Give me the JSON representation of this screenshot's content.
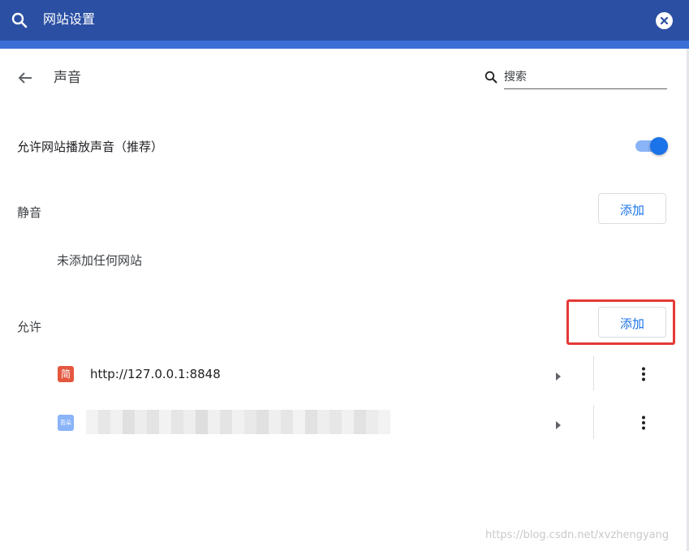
{
  "topbar": {
    "title": "网站设置",
    "search_icon": "search-icon",
    "close_icon": "close-circle-icon",
    "bg_color": "#2a4fa3"
  },
  "header": {
    "back_icon": "arrow-back-icon",
    "title": "声音",
    "search": {
      "icon": "search-icon",
      "placeholder": "搜索",
      "value": ""
    }
  },
  "allow_sound": {
    "label": "允许网站播放声音（推荐）",
    "toggle_on": true,
    "accent_color": "#1a73e8"
  },
  "mute_section": {
    "label": "静音",
    "add_label": "添加",
    "empty_text": "未添加任何网站"
  },
  "allow_section": {
    "label": "允许",
    "add_label": "添加",
    "highlight_color": "#e53935",
    "sites": [
      {
        "favicon_text": "简",
        "favicon_color": "#e4573f",
        "url": "http://127.0.0.1:8848",
        "arrow_icon": "triangle-right-icon",
        "more_icon": "more-vert-icon"
      },
      {
        "favicon_text": "吾朵",
        "favicon_color": "#8ab4f8",
        "url": "",
        "blurred": true,
        "arrow_icon": "triangle-right-icon",
        "more_icon": "more-vert-icon"
      }
    ]
  },
  "watermark": "https://blog.csdn.net/xvzhengyang"
}
